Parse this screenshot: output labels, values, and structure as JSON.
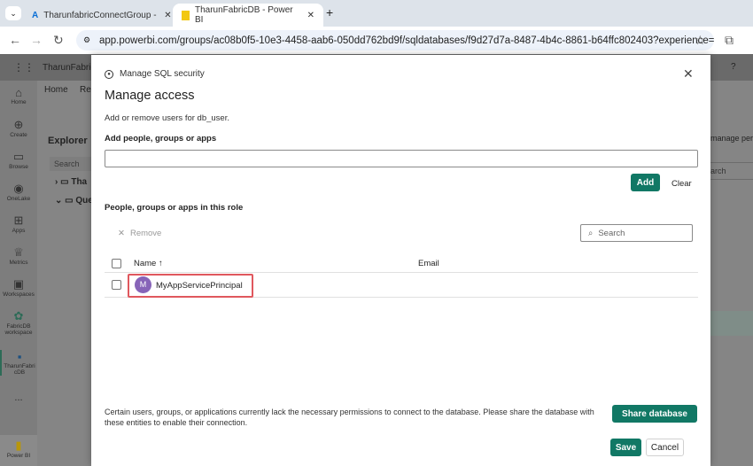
{
  "browser": {
    "tabs": [
      {
        "title": "TharunfabricConnectGroup - M",
        "icon": "azure-icon"
      },
      {
        "title": "TharunFabricDB - Power BI",
        "icon": "powerbi-icon"
      }
    ],
    "url": "app.powerbi.com/groups/ac08b0f5-10e3-4458-aab6-050dd762bd9f/sqldatabases/f9d27d7a-8487-4b4c-8861-b64ffc802403?experience=power-bi"
  },
  "app": {
    "title": "TharunFabricD",
    "ribbon": [
      "Home",
      "Rep"
    ],
    "explorer_title": "Explorer",
    "explorer_search": "Search",
    "tree": [
      "Tha",
      "Que"
    ],
    "right_text": "manage per",
    "right_search": "arch",
    "help": "?",
    "rail": [
      {
        "label": "Home",
        "icon": "home-icon"
      },
      {
        "label": "Create",
        "icon": "plus-circle-icon"
      },
      {
        "label": "Browse",
        "icon": "folder-icon"
      },
      {
        "label": "OneLake",
        "icon": "onelake-icon"
      },
      {
        "label": "Apps",
        "icon": "apps-icon"
      },
      {
        "label": "Metrics",
        "icon": "trophy-icon"
      },
      {
        "label": "Workspaces",
        "icon": "workspaces-icon"
      },
      {
        "label": "FabricDB workspace",
        "icon": "workspace-icon"
      },
      {
        "label": "TharunFabri cDB",
        "icon": "database-icon"
      }
    ],
    "more": "...",
    "brand": "Power BI"
  },
  "dialog": {
    "breadcrumb": "Manage SQL security",
    "title": "Manage access",
    "subtitle": "Add or remove users for db_user.",
    "add_label": "Add people, groups or apps",
    "add_input": "",
    "add_button": "Add",
    "clear_button": "Clear",
    "members_label": "People, groups or apps in this role",
    "remove_button": "Remove",
    "search_placeholder": "Search",
    "columns": {
      "name": "Name ↑",
      "email": "Email"
    },
    "rows": [
      {
        "initial": "M",
        "name": "MyAppServicePrincipal",
        "email": "",
        "avatar_color": "#8764b8"
      }
    ],
    "warning": "Certain users, groups, or applications currently lack the necessary permissions to connect to the database. Please share the database with these entities to enable their connection.",
    "share_button": "Share database",
    "save_button": "Save",
    "cancel_button": "Cancel"
  }
}
